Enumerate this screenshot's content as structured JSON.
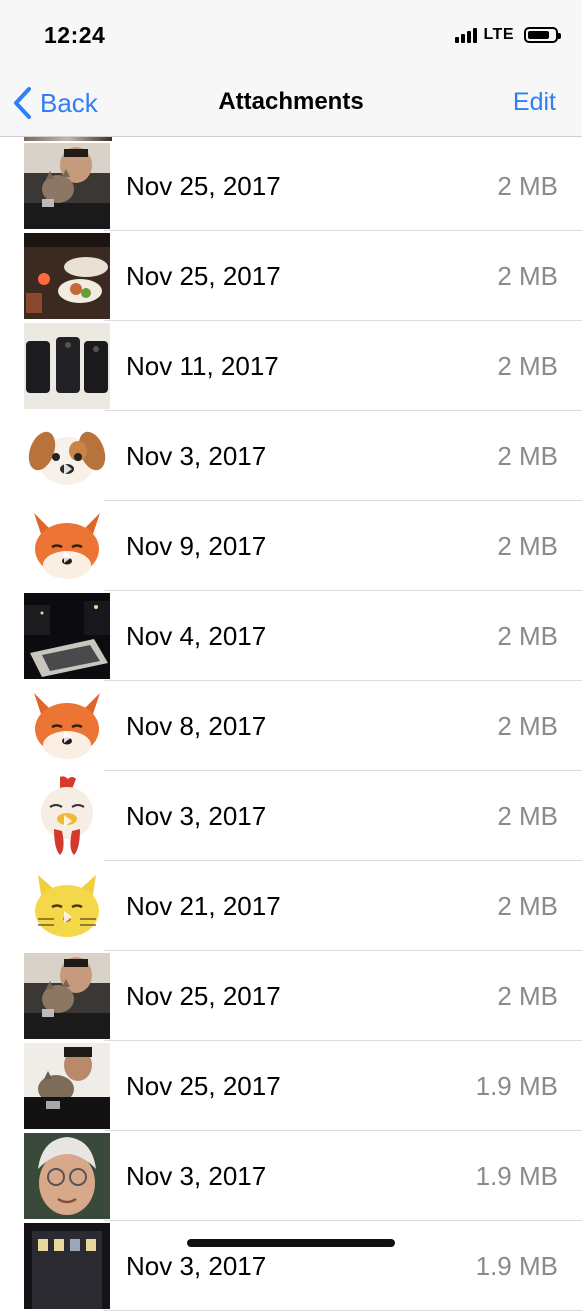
{
  "status_bar": {
    "time": "12:24",
    "network": "LTE",
    "battery_level": 0.8
  },
  "nav": {
    "back_label": "Back",
    "title": "Attachments",
    "edit_label": "Edit"
  },
  "colors": {
    "accent": "#2f7ff5",
    "secondary_text": "#8a8a8e",
    "separator": "#dcdcdc"
  },
  "attachments": [
    {
      "date": "Nov 25, 2017",
      "size": "2 MB",
      "thumbnail": "photo-man-with-cat"
    },
    {
      "date": "Nov 25, 2017",
      "size": "2 MB",
      "thumbnail": "photo-dinner-table"
    },
    {
      "date": "Nov 11, 2017",
      "size": "2 MB",
      "thumbnail": "photo-phones"
    },
    {
      "date": "Nov 3, 2017",
      "size": "2 MB",
      "thumbnail": "animoji-dog"
    },
    {
      "date": "Nov 9, 2017",
      "size": "2 MB",
      "thumbnail": "animoji-fox"
    },
    {
      "date": "Nov 4, 2017",
      "size": "2 MB",
      "thumbnail": "photo-night-city"
    },
    {
      "date": "Nov 8, 2017",
      "size": "2 MB",
      "thumbnail": "animoji-fox"
    },
    {
      "date": "Nov 3, 2017",
      "size": "2 MB",
      "thumbnail": "animoji-chicken"
    },
    {
      "date": "Nov 21, 2017",
      "size": "2 MB",
      "thumbnail": "animoji-cat"
    },
    {
      "date": "Nov 25, 2017",
      "size": "2 MB",
      "thumbnail": "photo-man-with-cat"
    },
    {
      "date": "Nov 25, 2017",
      "size": "1.9 MB",
      "thumbnail": "photo-man-hugging-cat"
    },
    {
      "date": "Nov 3, 2017",
      "size": "1.9 MB",
      "thumbnail": "photo-woman-glasses"
    },
    {
      "date": "Nov 3, 2017",
      "size": "1.9 MB",
      "thumbnail": "photo-building-night"
    }
  ]
}
